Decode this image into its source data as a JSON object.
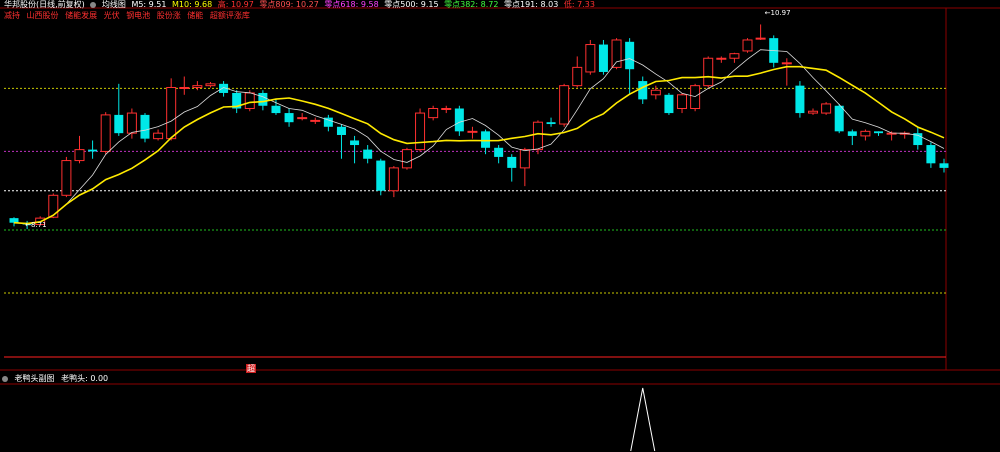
{
  "header": {
    "stock_name": "华邦股份(日线,前复权)",
    "indicator_name": "均线图",
    "ma5": "M5: 9.51",
    "ma10": "M10: 9.68",
    "hi": "高: 10.97",
    "fib809": "零点809: 10.27",
    "fib618": "零点618: 9.58",
    "fib500": "零点500: 9.15",
    "fib382": "零点382: 8.72",
    "fib191": "零点191: 8.03",
    "lo": "低: 7.33",
    "colors": {
      "ma5": "#ffffff",
      "ma10": "#ffff00",
      "hi": "#ff3030",
      "fib809": "#ff4040",
      "fib618": "#ff40ff",
      "fib500": "#ffffff",
      "fib382": "#40ff40",
      "fib191": "#ffffff",
      "lo": "#ff3030"
    }
  },
  "legend_row": [
    "减持",
    "山西股份",
    "储能发展",
    "光伏",
    "钢电池",
    "股份涨",
    "储能",
    "超额评涨库"
  ],
  "annotations": {
    "high_label": "10.97",
    "low_label": "8.71"
  },
  "sub_panel": {
    "title": "老鸭头副图",
    "value": "老鸭头: 0.00",
    "badge": "超"
  },
  "chart_data": {
    "type": "candlestick",
    "ylim": [
      7.33,
      11.15
    ],
    "hlines": [
      {
        "value": 10.27,
        "color": "#c8c800",
        "style": "dotted"
      },
      {
        "value": 9.58,
        "color": "#c030c0",
        "style": "dotted"
      },
      {
        "value": 9.15,
        "color": "#ffffff",
        "style": "dotted"
      },
      {
        "value": 8.72,
        "color": "#20c020",
        "style": "dotted"
      },
      {
        "value": 8.03,
        "color": "#c8c800",
        "style": "dotted"
      },
      {
        "value": 7.33,
        "color": "#ff2020",
        "style": "solid"
      }
    ],
    "candles": [
      [
        8.85,
        8.8,
        8.86,
        8.76
      ],
      [
        8.8,
        8.78,
        8.82,
        8.73
      ],
      [
        8.78,
        8.85,
        8.87,
        8.77
      ],
      [
        8.86,
        9.1,
        9.12,
        8.85
      ],
      [
        9.1,
        9.48,
        9.52,
        9.08
      ],
      [
        9.48,
        9.6,
        9.75,
        9.45
      ],
      [
        9.6,
        9.58,
        9.7,
        9.5
      ],
      [
        9.58,
        9.98,
        10.01,
        9.55
      ],
      [
        9.98,
        9.78,
        10.32,
        9.75
      ],
      [
        9.78,
        10.0,
        10.05,
        9.72
      ],
      [
        9.98,
        9.72,
        10.0,
        9.68
      ],
      [
        9.72,
        9.78,
        9.82,
        9.7
      ],
      [
        9.72,
        10.28,
        10.38,
        9.7
      ],
      [
        10.28,
        10.28,
        10.4,
        10.2
      ],
      [
        10.28,
        10.3,
        10.35,
        10.25
      ],
      [
        10.3,
        10.32,
        10.34,
        10.28
      ],
      [
        10.32,
        10.22,
        10.35,
        10.18
      ],
      [
        10.22,
        10.05,
        10.25,
        10.0
      ],
      [
        10.05,
        10.22,
        10.25,
        10.02
      ],
      [
        10.22,
        10.08,
        10.25,
        10.03
      ],
      [
        10.08,
        10.0,
        10.15,
        9.98
      ],
      [
        10.0,
        9.9,
        10.05,
        9.85
      ],
      [
        9.95,
        9.95,
        10.0,
        9.92
      ],
      [
        9.92,
        9.92,
        9.95,
        9.88
      ],
      [
        9.95,
        9.85,
        9.98,
        9.8
      ],
      [
        9.85,
        9.76,
        9.88,
        9.5
      ],
      [
        9.7,
        9.65,
        9.75,
        9.45
      ],
      [
        9.6,
        9.5,
        9.65,
        9.45
      ],
      [
        9.48,
        9.15,
        9.5,
        9.1
      ],
      [
        9.15,
        9.4,
        9.42,
        9.08
      ],
      [
        9.4,
        9.6,
        9.62,
        9.38
      ],
      [
        9.6,
        10.0,
        10.05,
        9.58
      ],
      [
        9.95,
        10.05,
        10.08,
        9.92
      ],
      [
        10.05,
        10.05,
        10.08,
        10.0
      ],
      [
        10.05,
        9.8,
        10.08,
        9.75
      ],
      [
        9.8,
        9.8,
        9.85,
        9.72
      ],
      [
        9.8,
        9.62,
        9.82,
        9.55
      ],
      [
        9.62,
        9.52,
        9.65,
        9.45
      ],
      [
        9.52,
        9.4,
        9.55,
        9.25
      ],
      [
        9.4,
        9.6,
        9.62,
        9.2
      ],
      [
        9.6,
        9.9,
        9.92,
        9.55
      ],
      [
        9.9,
        9.88,
        9.95,
        9.85
      ],
      [
        9.88,
        10.3,
        10.32,
        9.85
      ],
      [
        10.3,
        10.5,
        10.62,
        10.28
      ],
      [
        10.45,
        10.75,
        10.8,
        10.42
      ],
      [
        10.75,
        10.45,
        10.8,
        10.42
      ],
      [
        10.5,
        10.8,
        10.82,
        10.48
      ],
      [
        10.78,
        10.48,
        10.82,
        10.2
      ],
      [
        10.35,
        10.15,
        10.4,
        10.1
      ],
      [
        10.2,
        10.25,
        10.3,
        10.15
      ],
      [
        10.2,
        10.0,
        10.22,
        9.98
      ],
      [
        10.05,
        10.2,
        10.22,
        10.0
      ],
      [
        10.05,
        10.3,
        10.32,
        10.02
      ],
      [
        10.3,
        10.6,
        10.62,
        10.28
      ],
      [
        10.6,
        10.6,
        10.62,
        10.55
      ],
      [
        10.6,
        10.65,
        10.66,
        10.55
      ],
      [
        10.68,
        10.8,
        10.82,
        10.66
      ],
      [
        10.82,
        10.82,
        10.97,
        10.8
      ],
      [
        10.82,
        10.55,
        10.85,
        10.5
      ],
      [
        10.55,
        10.55,
        10.6,
        10.3
      ],
      [
        10.3,
        10.0,
        10.35,
        9.95
      ],
      [
        10.0,
        10.02,
        10.05,
        9.98
      ],
      [
        10.0,
        10.1,
        10.12,
        9.98
      ],
      [
        10.08,
        9.8,
        10.1,
        9.78
      ],
      [
        9.8,
        9.75,
        9.82,
        9.65
      ],
      [
        9.75,
        9.8,
        9.82,
        9.7
      ],
      [
        9.8,
        9.78,
        9.8,
        9.75
      ],
      [
        9.78,
        9.78,
        9.8,
        9.7
      ],
      [
        9.78,
        9.78,
        9.8,
        9.72
      ],
      [
        9.78,
        9.65,
        9.85,
        9.6
      ],
      [
        9.65,
        9.45,
        9.68,
        9.4
      ],
      [
        9.45,
        9.4,
        9.5,
        9.35
      ]
    ],
    "sub_series": {
      "peak_index": 48,
      "peak_value": 1,
      "ylim": [
        0,
        1
      ]
    }
  }
}
